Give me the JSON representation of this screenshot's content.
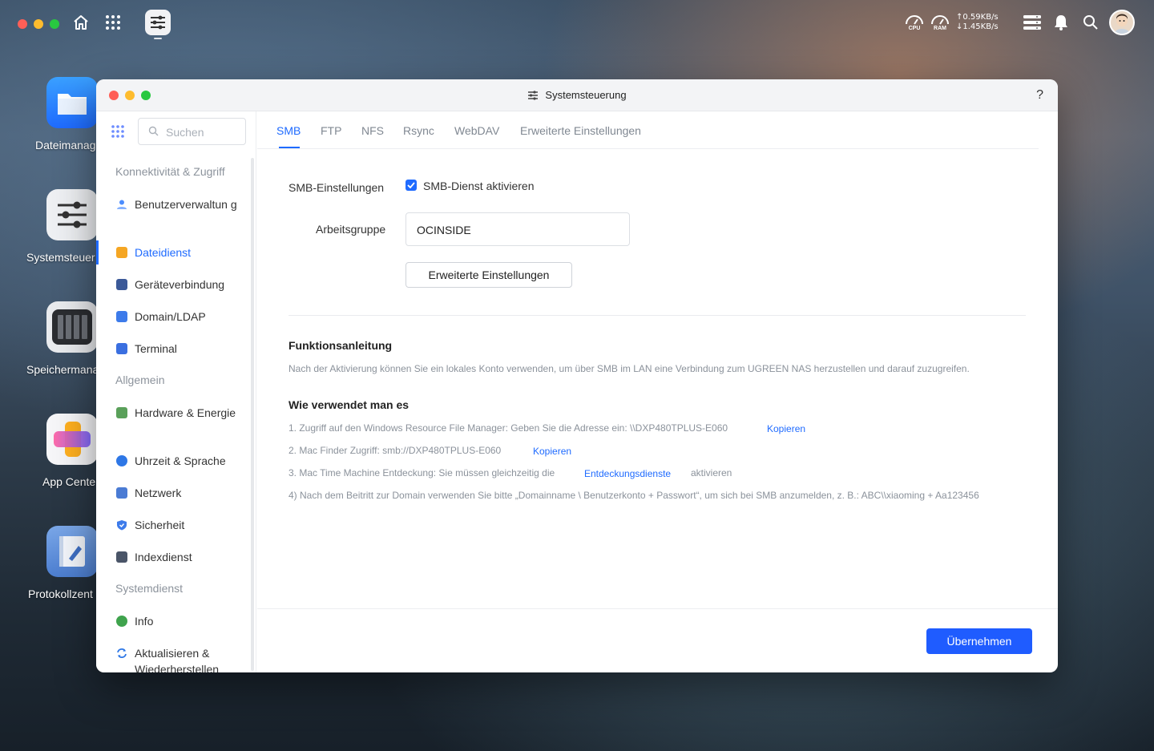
{
  "topbar": {
    "cpu_label": "CPU",
    "ram_label": "RAM",
    "upload_speed": "↑0.59KB/s",
    "download_speed": "↓1.45KB/s",
    "icons": [
      "home-icon",
      "app-grid-icon",
      "control-panel-icon",
      "storage-list-icon",
      "bell-icon",
      "search-icon",
      "avatar"
    ]
  },
  "desktop": {
    "icons": [
      {
        "label": "Dateimanag"
      },
      {
        "label": "Systemsteuer"
      },
      {
        "label": "Speichermana"
      },
      {
        "label": "App Cente"
      },
      {
        "label": "Protokollzent"
      }
    ]
  },
  "window": {
    "title": "Systemsteuerung",
    "help": "?"
  },
  "sidebar": {
    "search_placeholder": "Suchen",
    "sections": [
      {
        "title": "Konnektivität & Zugriff"
      },
      {
        "title": "Allgemein"
      },
      {
        "title": "Systemdienst"
      }
    ],
    "items": [
      {
        "label": "Benutzerverwaltun g",
        "color": "#4c8dff"
      },
      {
        "label": "Dateidienst",
        "color": "#f5a623",
        "active": true
      },
      {
        "label": "Geräteverbindung",
        "color": "#3b5998"
      },
      {
        "label": "Domain/LDAP",
        "color": "#3d7bea"
      },
      {
        "label": "Terminal",
        "color": "#3a6fe0"
      },
      {
        "label": "Hardware & Energie",
        "color": "#5aa05a"
      },
      {
        "label": "Uhrzeit & Sprache",
        "color": "#2e77e6"
      },
      {
        "label": "Netzwerk",
        "color": "#4a7bd4"
      },
      {
        "label": "Sicherheit",
        "color": "#3d7bea"
      },
      {
        "label": "Indexdienst",
        "color": "#4a5568"
      },
      {
        "label": "Info",
        "color": "#3fa34d"
      },
      {
        "label": "Aktualisieren & Wiederherstellen",
        "color": "#2e77e6"
      }
    ]
  },
  "tabs": [
    {
      "label": "SMB",
      "active": true
    },
    {
      "label": "FTP"
    },
    {
      "label": "NFS"
    },
    {
      "label": "Rsync"
    },
    {
      "label": "WebDAV"
    },
    {
      "label": "Erweiterte Einstellungen"
    }
  ],
  "smb": {
    "settings_label": "SMB-Einstellungen",
    "enable_checkbox_label": "SMB-Dienst aktivieren",
    "enable_checked": true,
    "workgroup_label": "Arbeitsgruppe",
    "workgroup_value": "OCINSIDE",
    "advanced_button": "Erweiterte Einstellungen"
  },
  "guide": {
    "title": "Funktionsanleitung",
    "description": "Nach der Aktivierung können Sie ein lokales Konto verwenden, um über SMB im LAN eine Verbindung zum UGREEN NAS herzustellen und darauf zuzugreifen.",
    "howto_title": "Wie verwendet man es",
    "step1": "1. Zugriff auf den Windows Resource File Manager: Geben Sie die Adresse ein: \\\\DXP480TPLUS-E060",
    "step1_link": "Kopieren",
    "step2": "2. Mac Finder Zugriff: smb://DXP480TPLUS-E060",
    "step2_link": "Kopieren",
    "step3": "3. Mac Time Machine Entdeckung: Sie müssen gleichzeitig die",
    "step3_link": "Entdeckungsdienste",
    "step3_suffix": "aktivieren",
    "step4": "4) Nach dem Beitritt zur Domain verwenden Sie bitte „Domainname \\ Benutzerkonto + Passwort“, um sich bei SMB anzumelden, z. B.: ABC\\\\xiaoming + Aa123456"
  },
  "footer": {
    "apply_button": "Übernehmen"
  }
}
